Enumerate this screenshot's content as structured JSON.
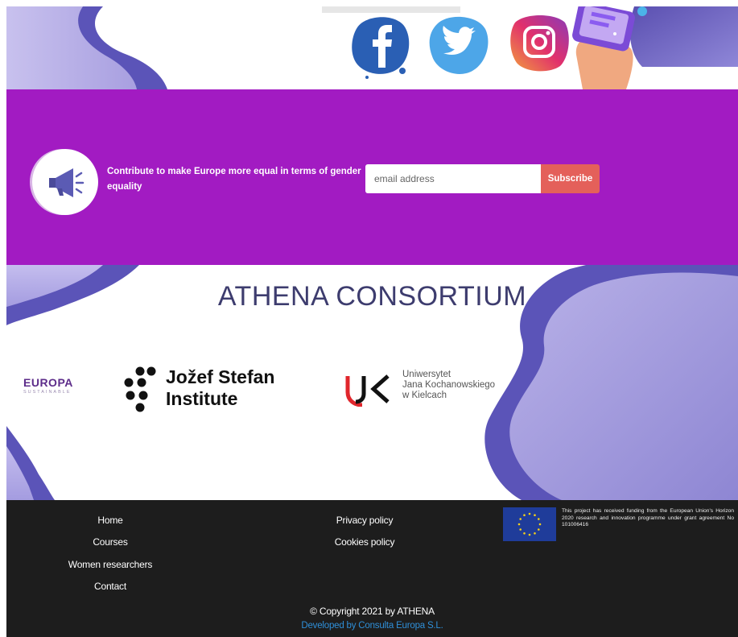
{
  "social": {
    "icons": [
      "facebook-icon",
      "twitter-icon",
      "instagram-icon"
    ]
  },
  "newsletter": {
    "text": "Contribute to make Europe more equal in terms of gender equality",
    "email_placeholder": "email address",
    "subscribe_label": "Subscribe",
    "background_color": "#a21bc2",
    "button_color": "#e4605a"
  },
  "consortium": {
    "title": "ATHENA CONSORTIUM",
    "partners": {
      "europa": {
        "name": "EUROPA",
        "tagline": "SUSTAINABLE"
      },
      "jsi": {
        "line1": "Jožef Stefan",
        "line2": "Institute"
      },
      "ujk": {
        "mark": "UJK",
        "line1": "Uniwersytet",
        "line2": "Jana Kochanowskiego",
        "line3": "w Kielcach"
      }
    }
  },
  "footer": {
    "left_links": [
      "Home",
      "Courses",
      "Women researchers",
      "Contact"
    ],
    "middle_links": [
      "Privacy policy",
      "Cookies policy"
    ],
    "eu_notice": "This project has received funding from the European Union's Horizon 2020 research and innovation programme under grant agreement No 101006416",
    "copyright": "© Copyright 2021 by ATHENA",
    "developed_by": "Developed by Consulta Europa S.L."
  }
}
